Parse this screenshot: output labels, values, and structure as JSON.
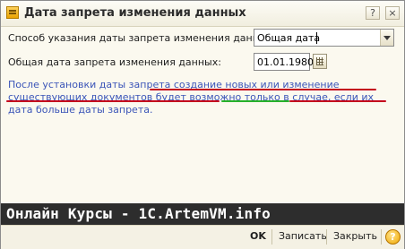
{
  "window": {
    "title": "Дата запрета изменения данных",
    "help_glyph": "?",
    "close_glyph": "×"
  },
  "form": {
    "method_label": "Способ указания даты запрета изменения данных:",
    "method_value": "Общая дата",
    "date_label": "Общая дата запрета изменения данных:",
    "date_value": "01.01.1980",
    "info_text": "После установки даты запрета создание новых или изменение существующих документов будет возможно только в случае, если их дата больше даты запрета."
  },
  "banner": {
    "text": "Онлайн Курсы - 1C.ArtemVM.info"
  },
  "footer": {
    "ok_label": "OK",
    "write_label": "Записать",
    "close_label": "Закрыть",
    "help_glyph": "?"
  },
  "colors": {
    "info_text": "#3b55b8",
    "underline_red": "#c4001c",
    "underline_green": "#27b12a",
    "banner_bg": "#2d2d2d"
  },
  "icons": [
    "form-icon",
    "help-icon",
    "close-icon",
    "dropdown-arrow-icon",
    "calendar-icon"
  ]
}
